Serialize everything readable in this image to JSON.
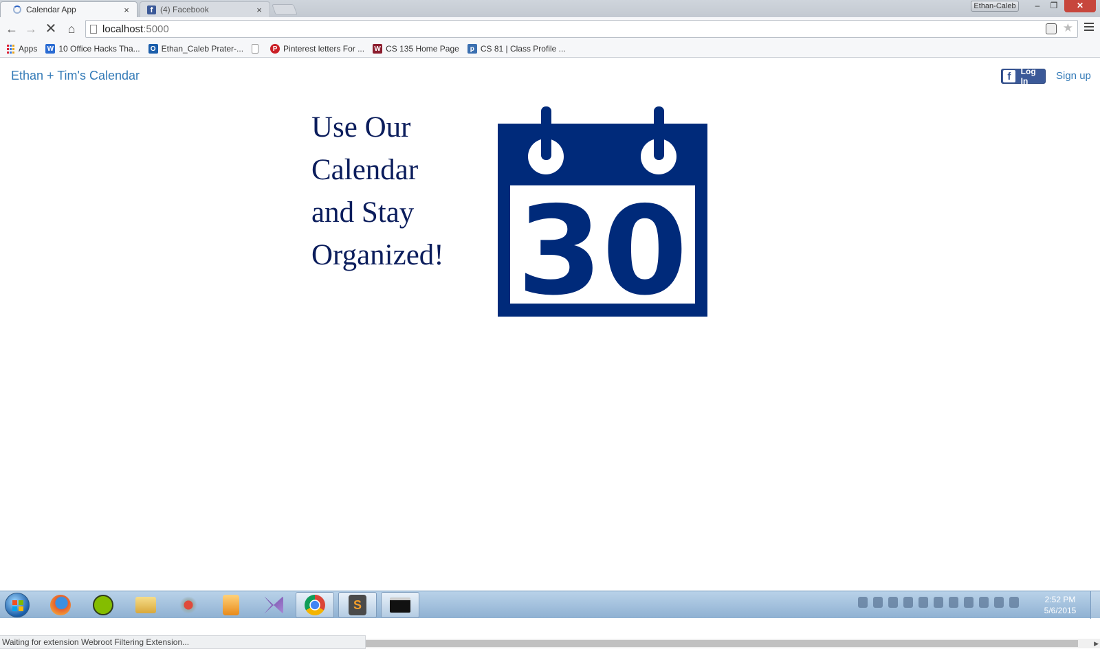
{
  "browser": {
    "tabs": [
      {
        "title": "Calendar App",
        "active": true,
        "loading": true
      },
      {
        "title": "(4) Facebook",
        "active": false,
        "favicon": "facebook-icon"
      }
    ],
    "tab_close_glyph": "×",
    "profile_name": "Ethan-Caleb",
    "url": {
      "host": "localhost",
      "port": ":5000"
    },
    "bookmarks": [
      {
        "label": "Apps",
        "icon": "apps-icon"
      },
      {
        "label": "10 Office Hacks Tha...",
        "icon": "word-icon"
      },
      {
        "label": "Ethan_Caleb Prater-...",
        "icon": "outlook-icon"
      },
      {
        "label": "",
        "icon": "blank-page-icon"
      },
      {
        "label": "Pinterest letters For ...",
        "icon": "pinterest-icon"
      },
      {
        "label": "CS 135 Home Page",
        "icon": "cs-logo-icon"
      },
      {
        "label": "CS 81 | Class Profile ...",
        "icon": "piazza-icon"
      }
    ],
    "status_text": "Waiting for extension Webroot Filtering Extension..."
  },
  "page": {
    "brand": "Ethan + Tim's Calendar",
    "fb_login_label": "Log In",
    "signup_label": "Sign up",
    "hero_lines": [
      "Use Our",
      "Calendar",
      "and Stay",
      "Organized!"
    ],
    "calendar_icon_number": "30",
    "colors": {
      "navy": "#002a7a",
      "link": "#337ab7",
      "hero_text": "#0b1d5c",
      "facebook": "#3b5998"
    }
  },
  "taskbar": {
    "apps": [
      "firefox-icon",
      "spotify-icon",
      "file-explorer-icon",
      "network-app-icon",
      "media-player-icon",
      "visual-studio-icon",
      "chrome-icon",
      "sublime-text-icon",
      "command-prompt-icon"
    ],
    "clock_time": "2:52 PM",
    "clock_date": "5/6/2015"
  }
}
